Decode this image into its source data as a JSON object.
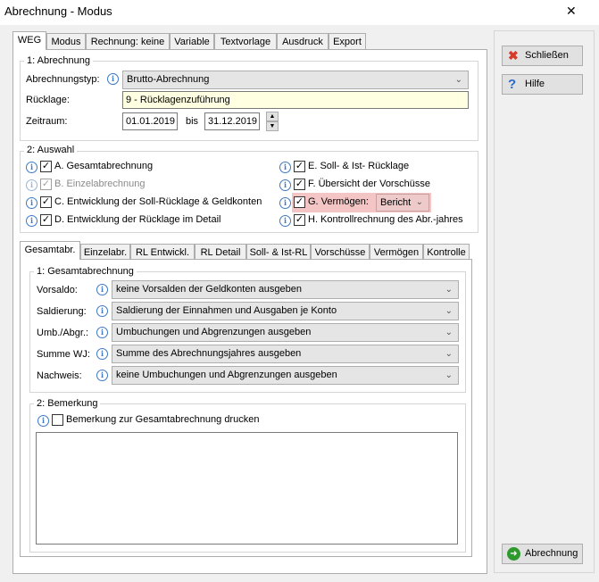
{
  "window": {
    "title": "Abrechnung - Modus",
    "close_label": "✕"
  },
  "top_tabs": [
    "WEG",
    "Modus",
    "Rechnung: keine",
    "Variable",
    "Textvorlage",
    "Ausdruck",
    "Export"
  ],
  "section1": {
    "title": "1: Abrechnung",
    "type_label": "Abrechnungstyp:",
    "type_value": "Brutto-Abrechnung",
    "reserve_label": "Rücklage:",
    "reserve_value": "9 - Rücklagenzuführung",
    "period_label": "Zeitraum:",
    "period_from": "01.01.2019",
    "period_to_label": "bis",
    "period_to": "31.12.2019"
  },
  "section2": {
    "title": "2: Auswahl",
    "left": [
      {
        "label": "A. Gesamtabrechnung",
        "checked": true,
        "enabled": true
      },
      {
        "label": "B. Einzelabrechnung",
        "checked": true,
        "enabled": false
      },
      {
        "label": "C. Entwicklung der Soll-Rücklage & Geldkonten",
        "checked": true,
        "enabled": true
      },
      {
        "label": "D. Entwicklung der Rücklage im Detail",
        "checked": true,
        "enabled": true
      }
    ],
    "right": [
      {
        "label": "E. Soll- & Ist- Rücklage",
        "checked": true
      },
      {
        "label": "F. Übersicht der Vorschüsse",
        "checked": true
      },
      {
        "label": "G. Vermögen:",
        "checked": true,
        "dropdown": "Bericht"
      },
      {
        "label": "H. Kontrollrechnung des Abr.-jahres",
        "checked": true
      }
    ]
  },
  "sub_tabs": [
    "Gesamtabr.",
    "Einzelabr.",
    "RL Entwickl.",
    "RL Detail",
    "Soll- & Ist-RL",
    "Vorschüsse",
    "Vermögen",
    "Kontrolle"
  ],
  "gesamt": {
    "title": "1: Gesamtabrechnung",
    "rows": [
      {
        "label": "Vorsaldo:",
        "value": "keine Vorsalden der Geldkonten ausgeben"
      },
      {
        "label": "Saldierung:",
        "value": "Saldierung der Einnahmen und Ausgaben je Konto"
      },
      {
        "label": "Umb./Abgr.:",
        "value": "Umbuchungen und Abgrenzungen ausgeben"
      },
      {
        "label": "Summe WJ:",
        "value": "Summe des Abrechnungsjahres ausgeben"
      },
      {
        "label": "Nachweis:",
        "value": "keine Umbuchungen und Abgrenzungen ausgeben"
      }
    ]
  },
  "bemerkung": {
    "title": "2: Bemerkung",
    "checkbox_label": "Bemerkung zur Gesamtabrechnung drucken",
    "text": ""
  },
  "buttons": {
    "close": "Schließen",
    "help": "Hilfe",
    "run": "Abrechnung"
  },
  "icons": {
    "info": "info-icon",
    "close": "red-x-icon",
    "help": "question-icon",
    "run": "green-arrow-icon"
  }
}
